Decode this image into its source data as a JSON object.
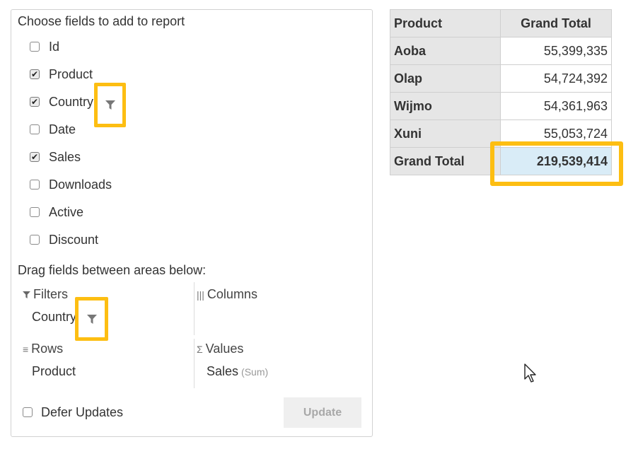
{
  "field_chooser": {
    "title": "Choose fields to add to report",
    "fields": [
      {
        "label": "Id",
        "checked": false
      },
      {
        "label": "Product",
        "checked": true
      },
      {
        "label": "Country",
        "checked": true
      },
      {
        "label": "Date",
        "checked": false
      },
      {
        "label": "Sales",
        "checked": true
      },
      {
        "label": "Downloads",
        "checked": false
      },
      {
        "label": "Active",
        "checked": false
      },
      {
        "label": "Discount",
        "checked": false
      }
    ]
  },
  "areas": {
    "title": "Drag fields between areas below:",
    "filters": {
      "label": "Filters",
      "items": [
        "Country"
      ]
    },
    "columns": {
      "label": "Columns",
      "items": []
    },
    "rows": {
      "label": "Rows",
      "items": [
        "Product"
      ]
    },
    "values": {
      "label": "Values",
      "items": [
        {
          "field": "Sales",
          "aggregate": "(Sum)"
        }
      ]
    }
  },
  "footer": {
    "defer_label": "Defer Updates",
    "defer_checked": false,
    "update_label": "Update"
  },
  "pivot_grid": {
    "headers": [
      "Product",
      "Grand Total"
    ],
    "rows": [
      {
        "label": "Aoba",
        "value": "55,399,335"
      },
      {
        "label": "Olap",
        "value": "54,724,392"
      },
      {
        "label": "Wijmo",
        "value": "54,361,963"
      },
      {
        "label": "Xuni",
        "value": "55,053,724"
      }
    ],
    "total": {
      "label": "Grand Total",
      "value": "219,539,414"
    }
  },
  "colors": {
    "highlight": "#fdbe12",
    "total_cell": "#d9ecf7",
    "header_bg": "#e6e6e6"
  },
  "icons": {
    "filter": "funnel-icon",
    "columns": "columns-icon",
    "rows": "rows-icon",
    "values": "sigma-icon",
    "cursor": "mouse-pointer-icon"
  }
}
